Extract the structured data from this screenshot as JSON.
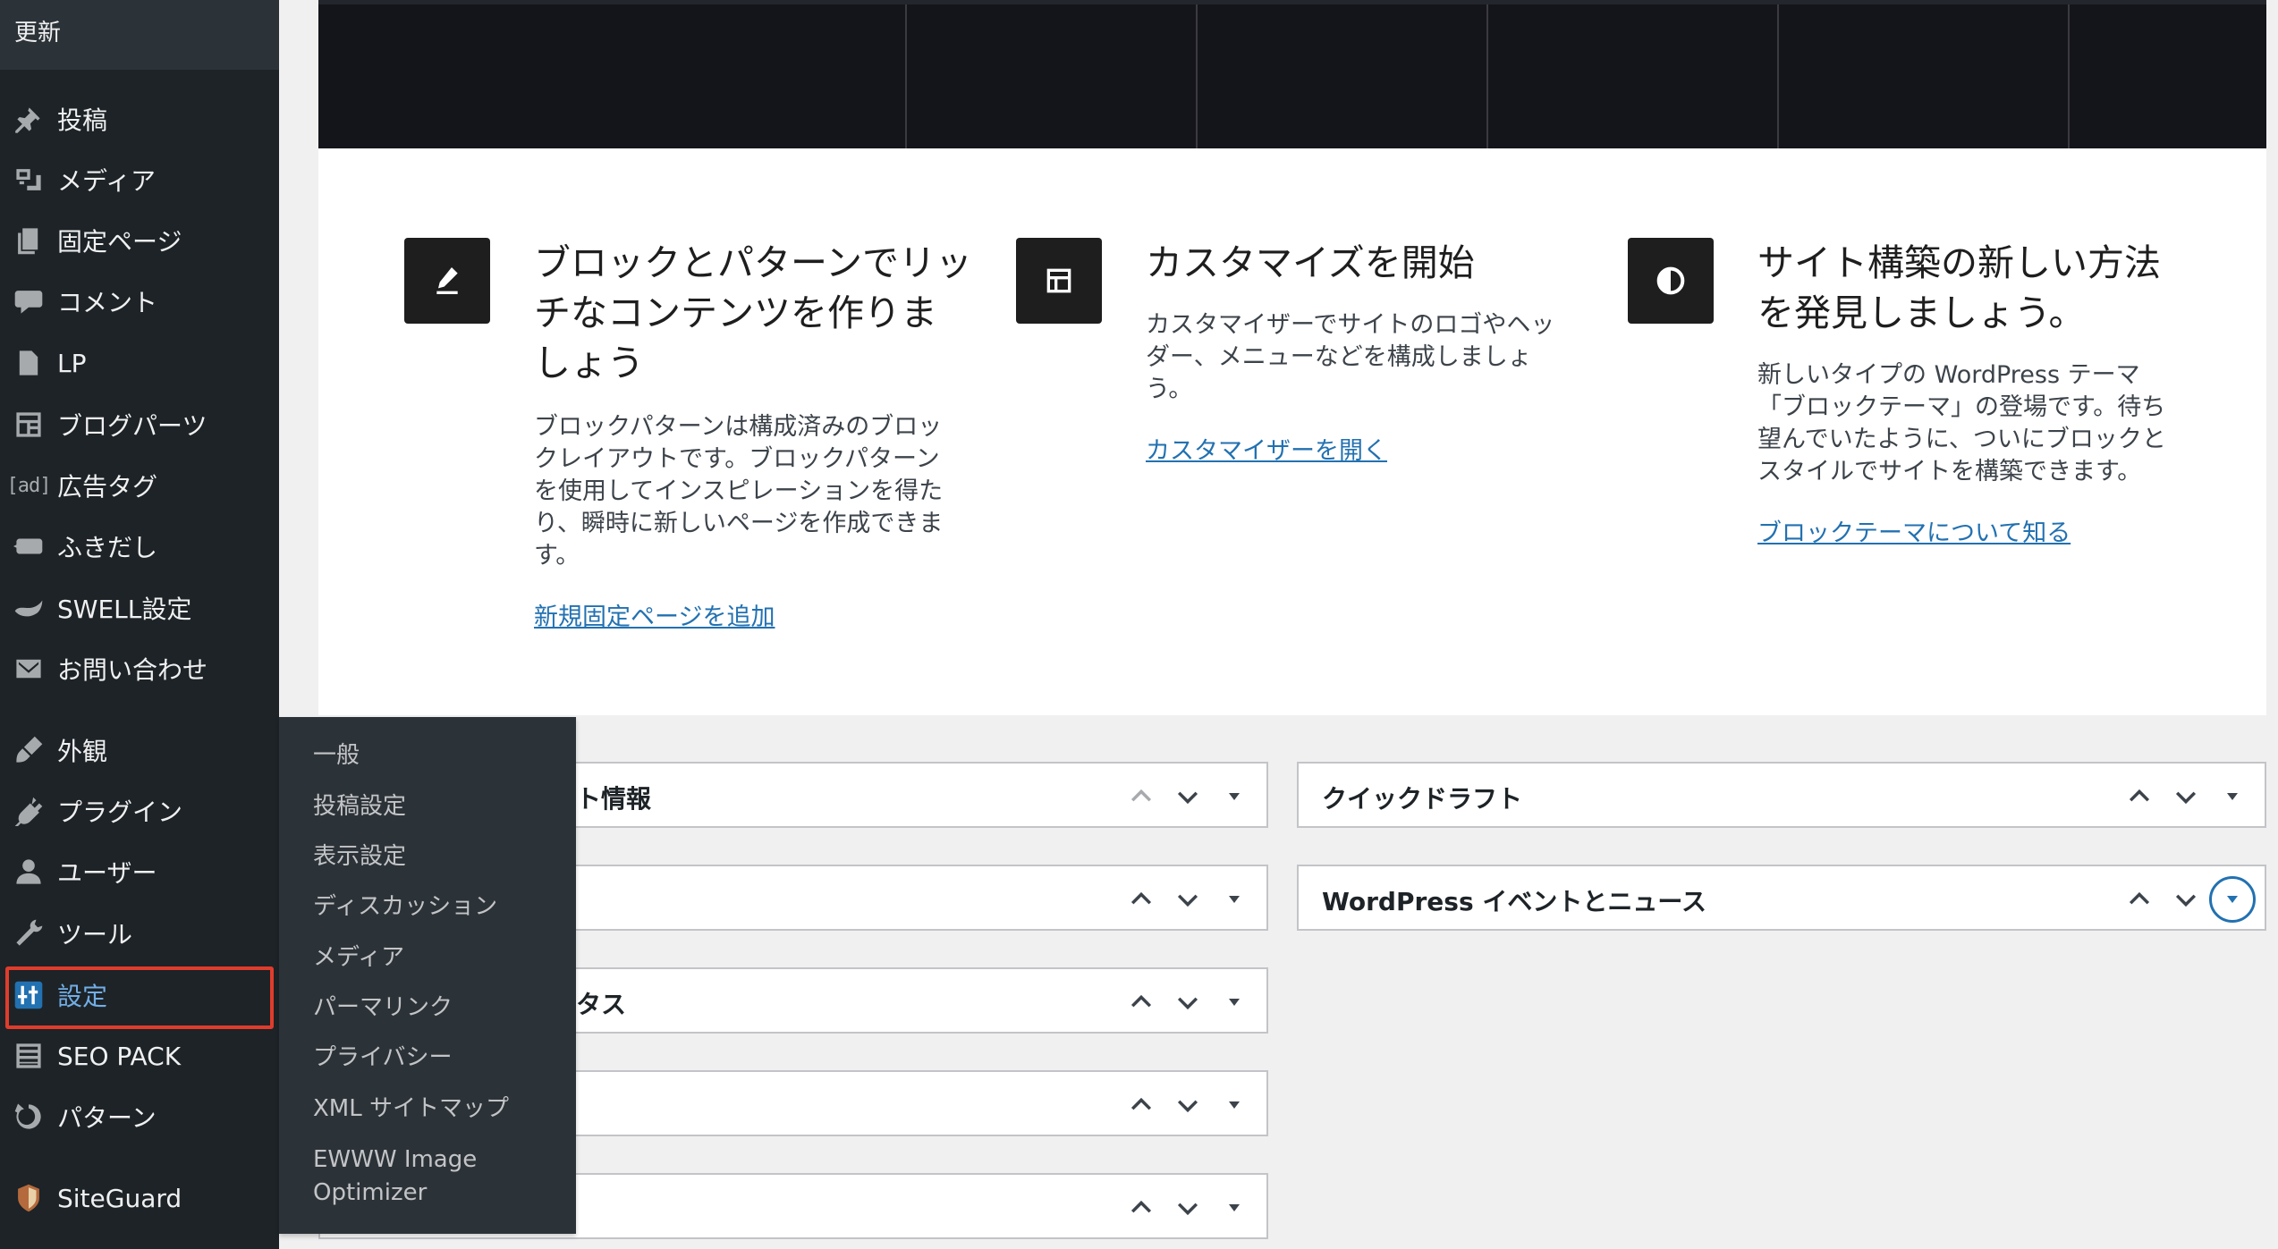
{
  "sidebar": {
    "updates_label": "更新",
    "items": [
      {
        "label": "投稿",
        "icon": "pin-icon"
      },
      {
        "label": "メディア",
        "icon": "media-icon"
      },
      {
        "label": "固定ページ",
        "icon": "page-icon"
      },
      {
        "label": "コメント",
        "icon": "comment-icon"
      },
      {
        "label": "LP",
        "icon": "page-icon"
      },
      {
        "label": "ブログパーツ",
        "icon": "layout-icon"
      },
      {
        "label": "広告タグ",
        "icon": "ad-icon",
        "icon_text": "[ad]"
      },
      {
        "label": "ふきだし",
        "icon": "speech-bubble-icon"
      },
      {
        "label": "SWELL設定",
        "icon": "swell-icon"
      },
      {
        "label": "お問い合わせ",
        "icon": "mail-icon"
      },
      {
        "label": "外観",
        "icon": "brush-icon"
      },
      {
        "label": "プラグイン",
        "icon": "plugin-icon"
      },
      {
        "label": "ユーザー",
        "icon": "user-icon"
      },
      {
        "label": "ツール",
        "icon": "wrench-icon"
      },
      {
        "label": "設定",
        "icon": "settings-icon",
        "active": true
      },
      {
        "label": "SEO PACK",
        "icon": "list-icon"
      },
      {
        "label": "パターン",
        "icon": "refresh-icon"
      },
      {
        "label": "SiteGuard",
        "icon": "siteguard-icon"
      }
    ]
  },
  "settings_submenu": [
    "一般",
    "投稿設定",
    "表示設定",
    "ディスカッション",
    "メディア",
    "パーマリンク",
    "プライバシー",
    "XML サイトマップ",
    "EWWW Image",
    "Optimizer"
  ],
  "welcome": {
    "columns": [
      {
        "icon": "edit-pencil-icon",
        "title_lines": [
          "ブロックとパターンでリッ",
          "チなコンテンツを作りま",
          "しょう"
        ],
        "desc_lines": [
          "ブロックパターンは構成済みのブロッ",
          "クレイアウトです。ブロックパターン",
          "を使用してインスピレーションを得た",
          "り、瞬時に新しいページを作成できま",
          "す。"
        ],
        "link": "新規固定ページを追加"
      },
      {
        "icon": "layout-icon",
        "title_lines": [
          "カスタマイズを開始"
        ],
        "desc_lines": [
          "カスタマイザーでサイトのロゴやヘッ",
          "ダー、メニューなどを構成しましょ",
          "う。"
        ],
        "link": "カスタマイザーを開く"
      },
      {
        "icon": "contrast-icon",
        "title_lines": [
          "サイト構築の新しい方法",
          "を発見しましょう。"
        ],
        "desc_lines": [
          "新しいタイプの WordPress テーマ",
          "「ブロックテーマ」の登場です。待ち",
          "望んでいたように、ついにブロックと",
          "スタイルでサイトを構築できます。"
        ],
        "link": "ブロックテーマについて知る"
      }
    ]
  },
  "postboxes_left": [
    {
      "title": "ト情報"
    },
    {
      "title": ""
    },
    {
      "title": "タス"
    },
    {
      "title": ""
    },
    {
      "title": ""
    }
  ],
  "postboxes_right": [
    {
      "title": "クイックドラフト"
    },
    {
      "title": "WordPress イベントとニュース"
    }
  ],
  "colors": {
    "sidebar_bg": "#1d2327",
    "submenu_bg": "#2c3338",
    "accent": "#2271b1",
    "highlight": "#e03c2c"
  }
}
